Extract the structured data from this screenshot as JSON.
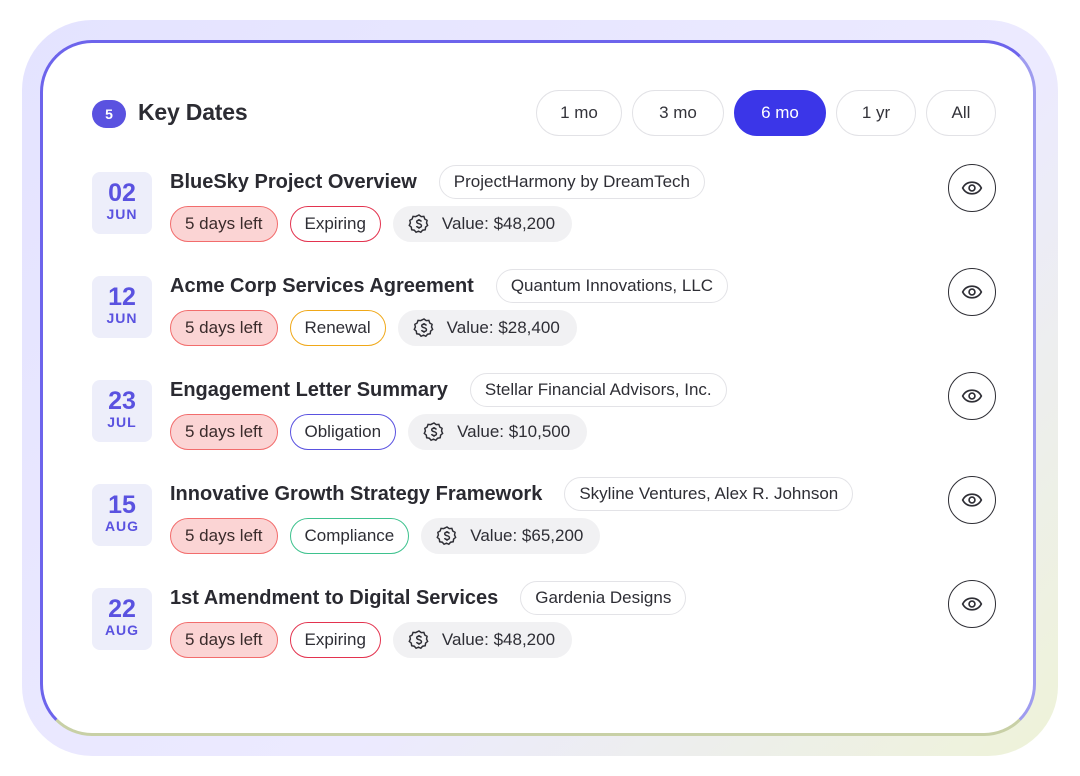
{
  "header": {
    "count": "5",
    "title": "Key Dates"
  },
  "filters": [
    {
      "label": "1 mo",
      "active": false
    },
    {
      "label": "3 mo",
      "active": false
    },
    {
      "label": "6 mo",
      "active": true
    },
    {
      "label": "1 yr",
      "active": false
    },
    {
      "label": "All",
      "active": false
    }
  ],
  "colors": {
    "accent": "#3b36e8",
    "badge": "#5a52e0",
    "date_bg": "#edeefa",
    "days_left_bg": "#fbd4d4",
    "days_left_border": "#f26c6c",
    "tag_expiring": "#e3334f",
    "tag_renewal": "#f0a818",
    "tag_obligation": "#5a52e0",
    "tag_compliance": "#3ec28e"
  },
  "icons": {
    "value": "dollar-circle-icon",
    "view": "eye-icon"
  },
  "items": [
    {
      "day": "02",
      "month": "JUN",
      "title": "BlueSky Project Overview",
      "company": "ProjectHarmony by DreamTech",
      "days_left": "5 days left",
      "tag": "Expiring",
      "tag_color": "#e3334f",
      "value": "Value: $48,200"
    },
    {
      "day": "12",
      "month": "JUN",
      "title": "Acme Corp Services Agreement",
      "company": "Quantum Innovations, LLC",
      "days_left": "5 days left",
      "tag": "Renewal",
      "tag_color": "#f0a818",
      "value": "Value: $28,400"
    },
    {
      "day": "23",
      "month": "JUL",
      "title": "Engagement Letter Summary",
      "company": "Stellar Financial Advisors, Inc.",
      "days_left": "5 days left",
      "tag": "Obligation",
      "tag_color": "#5a52e0",
      "value": "Value: $10,500"
    },
    {
      "day": "15",
      "month": "AUG",
      "title": "Innovative Growth Strategy Framework",
      "company": "Skyline Ventures, Alex R. Johnson",
      "days_left": "5 days left",
      "tag": "Compliance",
      "tag_color": "#3ec28e",
      "value": "Value: $65,200"
    },
    {
      "day": "22",
      "month": "AUG",
      "title": "1st Amendment to Digital Services",
      "company": "Gardenia Designs",
      "days_left": "5 days left",
      "tag": "Expiring",
      "tag_color": "#e3334f",
      "value": "Value: $48,200"
    }
  ]
}
